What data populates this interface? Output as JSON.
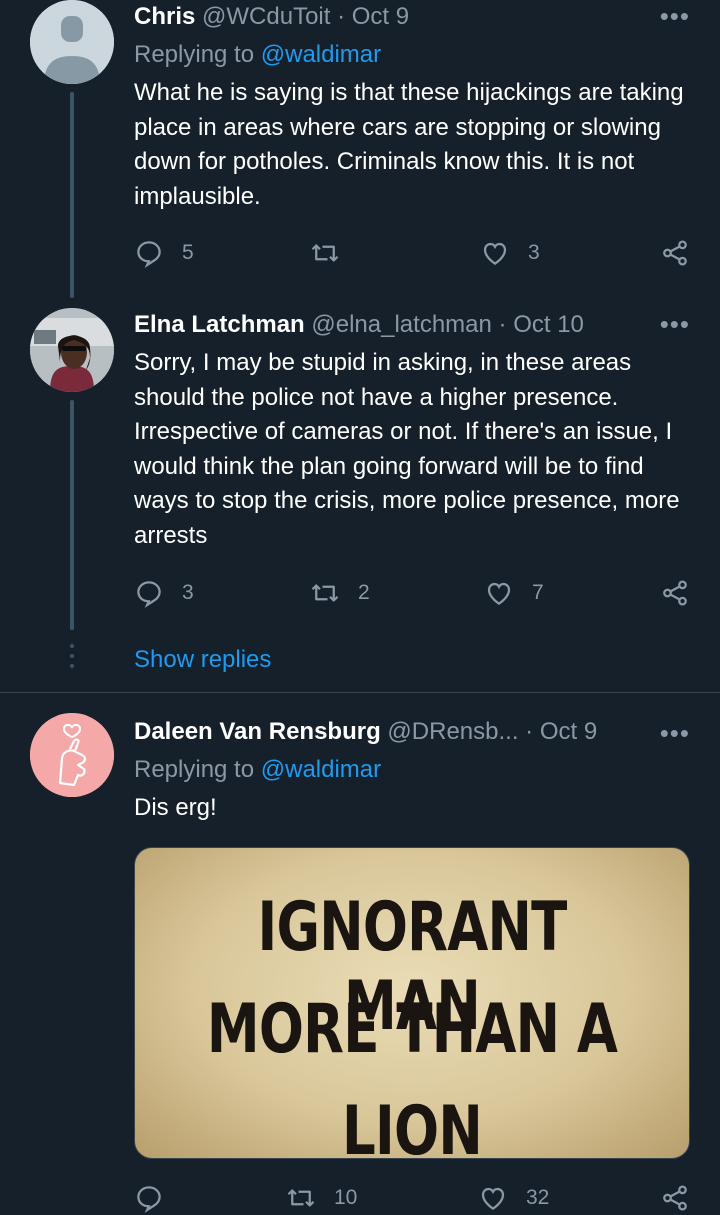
{
  "tweets": [
    {
      "name": "Chris",
      "handle": "@WCduToit",
      "dot": "·",
      "date": "Oct 9",
      "replying_prefix": "Replying to",
      "replying_to": "@waldimar",
      "text": "What he is saying is that these hijackings are taking place in areas where cars are stopping or slowing down for potholes. Criminals know this. It is not implausible.",
      "replies": "5",
      "retweets": "",
      "likes": "3"
    },
    {
      "name": "Elna Latchman",
      "handle": "@elna_latchman",
      "dot": "·",
      "date": "Oct 10",
      "text": "Sorry, I may be stupid in asking,  in these areas should the police not have a higher presence. Irrespective of cameras or not. If there's an issue, I would think the plan going forward will be to find ways to stop the crisis, more police presence, more arrests",
      "replies": "3",
      "retweets": "2",
      "likes": "7"
    },
    {
      "name": "Daleen Van Rensburg",
      "handle": "@DRensb...",
      "dot": "·",
      "date": "Oct 9",
      "replying_prefix": "Replying to",
      "replying_to": "@waldimar",
      "text": "Dis erg!",
      "media_lines": [
        "IGNORANT MAN",
        "MORE THAN A",
        "LION"
      ],
      "replies": "",
      "retweets": "10",
      "likes": "32"
    }
  ],
  "more_label": "•••",
  "show_replies": "Show replies",
  "colors": {
    "background": "#15202b",
    "accent": "#1d9bf0",
    "muted": "#8b98a5",
    "thread_line": "#3d5466"
  },
  "icons": {
    "reply": "reply-icon",
    "retweet": "retweet-icon",
    "like": "heart-icon",
    "share": "share-icon"
  }
}
